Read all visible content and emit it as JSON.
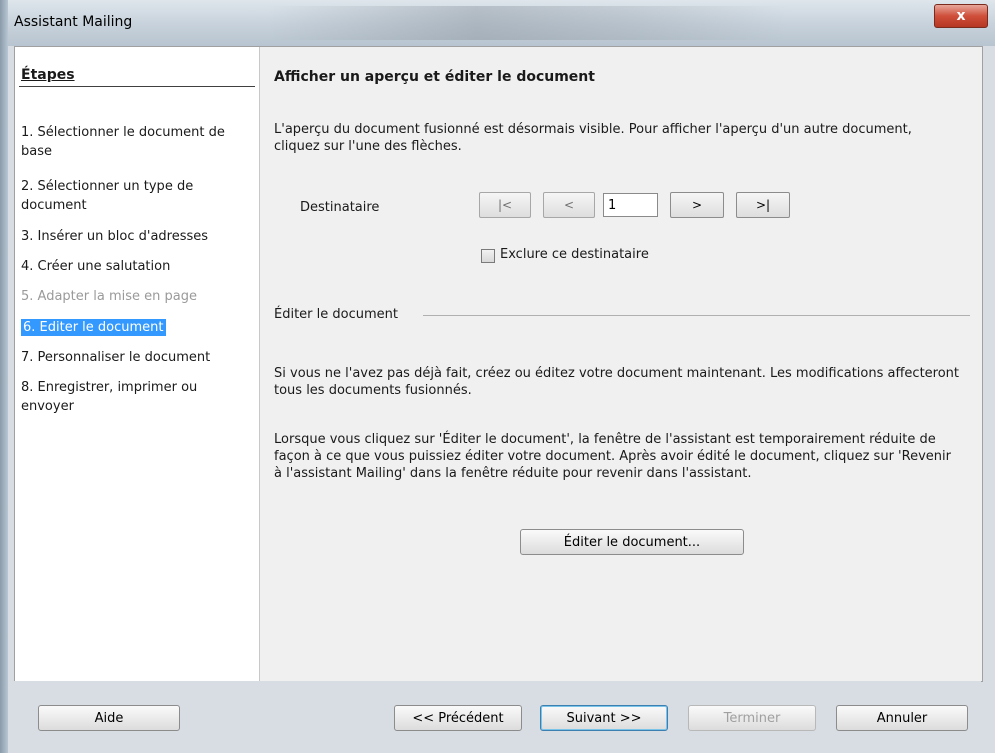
{
  "window": {
    "title": "Assistant Mailing",
    "close_label": "x"
  },
  "sidebar": {
    "heading": "Étapes",
    "steps": [
      {
        "label": "1. Sélectionner le document de base",
        "state": "normal"
      },
      {
        "label": "2. Sélectionner un type de document",
        "state": "normal"
      },
      {
        "label": "3. Insérer un bloc d'adresses",
        "state": "normal"
      },
      {
        "label": "4. Créer une salutation",
        "state": "normal"
      },
      {
        "label": "5. Adapter la mise en page",
        "state": "disabled"
      },
      {
        "label": "6. Editer le document",
        "state": "selected"
      },
      {
        "label": "7. Personnaliser le document",
        "state": "normal"
      },
      {
        "label": "8. Enregistrer, imprimer ou envoyer",
        "state": "normal"
      }
    ]
  },
  "main": {
    "title": "Afficher un aperçu et éditer le document",
    "intro": "L'aperçu du document fusionné est désormais visible. Pour afficher l'aperçu d'un autre document, cliquez sur l'une des flèches.",
    "recipient": {
      "label": "Destinataire",
      "first_label": "|<",
      "prev_label": "<",
      "value": "1",
      "next_label": ">",
      "last_label": ">|",
      "exclude_label": "Exclure ce destinataire",
      "exclude_checked": false
    },
    "edit_section": {
      "title": "Éditer le document",
      "para1": "Si vous ne l'avez pas déjà fait, créez ou éditez votre document maintenant. Les modifications affecteront tous les documents fusionnés.",
      "para2": "Lorsque vous cliquez sur 'Éditer le document', la fenêtre de l'assistant est temporairement réduite de façon à ce que vous puissiez éditer votre document. Après avoir édité le document, cliquez sur 'Revenir à l'assistant Mailing' dans la fenêtre réduite pour revenir dans l'assistant.",
      "button_label": "Éditer le document..."
    }
  },
  "footer": {
    "help_label": "Aide",
    "previous_label": "<< Précédent",
    "next_label": "Suivant >>",
    "finish_label": "Terminer",
    "cancel_label": "Annuler"
  }
}
